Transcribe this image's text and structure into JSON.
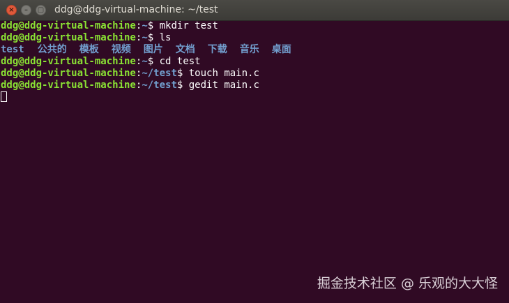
{
  "window": {
    "title": "ddg@ddg-virtual-machine: ~/test",
    "close_glyph": "×",
    "minimize_glyph": "–",
    "maximize_glyph": "▢",
    "icons": [
      "close-icon",
      "minimize-icon",
      "maximize-icon"
    ]
  },
  "terminal": {
    "colors": {
      "background": "#300a24",
      "user_host": "#8ae234",
      "path": "#729fcf",
      "text": "#ffffff"
    },
    "lines": [
      {
        "user": "ddg@ddg-virtual-machine",
        "sep": ":",
        "path": "~",
        "prompt": "$ ",
        "command": "mkdir test"
      },
      {
        "user": "ddg@ddg-virtual-machine",
        "sep": ":",
        "path": "~",
        "prompt": "$ ",
        "command": "ls"
      },
      {
        "user": "ddg@ddg-virtual-machine",
        "sep": ":",
        "path": "~",
        "prompt": "$ ",
        "command": "cd test"
      },
      {
        "user": "ddg@ddg-virtual-machine",
        "sep": ":",
        "path": "~/test",
        "prompt": "$ ",
        "command": "touch main.c"
      },
      {
        "user": "ddg@ddg-virtual-machine",
        "sep": ":",
        "path": "~/test",
        "prompt": "$ ",
        "command": "gedit main.c"
      }
    ],
    "ls_output": [
      "test",
      "公共的",
      "模板",
      "视频",
      "图片",
      "文档",
      "下载",
      "音乐",
      "桌面"
    ]
  },
  "watermark": "掘金技术社区 @ 乐观的大大怪"
}
